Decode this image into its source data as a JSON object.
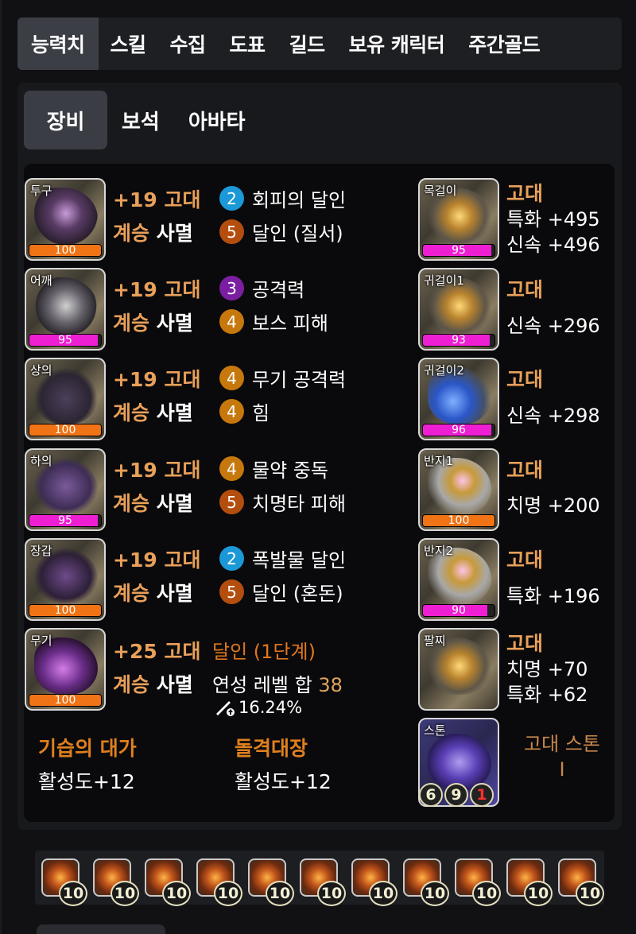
{
  "top_tabs": [
    "능력치",
    "스킬",
    "수집",
    "도표",
    "길드",
    "보유 캐릭터",
    "주간골드"
  ],
  "sub_tabs": [
    "장비",
    "보석",
    "아바타"
  ],
  "equipment": [
    {
      "slot": "투구",
      "quality": "100",
      "quality_pct": 100,
      "quality_color": "#f07316",
      "upgrade": "+19 고대",
      "succession_label": "계승",
      "set": "사멸",
      "engravings": [
        {
          "level": "2",
          "name": "회피의 달인",
          "color": "#1b98d8"
        },
        {
          "level": "5",
          "name": "달인 (질서)",
          "color": "#b44e0e"
        }
      ]
    },
    {
      "slot": "어깨",
      "quality": "95",
      "quality_pct": 95,
      "quality_color": "#ee1fd2",
      "upgrade": "+19 고대",
      "succession_label": "계승",
      "set": "사멸",
      "engravings": [
        {
          "level": "3",
          "name": "공격력",
          "color": "#7b1fa2"
        },
        {
          "level": "4",
          "name": "보스 피해",
          "color": "#c7780d"
        }
      ]
    },
    {
      "slot": "상의",
      "quality": "100",
      "quality_pct": 100,
      "quality_color": "#f07316",
      "upgrade": "+19 고대",
      "succession_label": "계승",
      "set": "사멸",
      "engravings": [
        {
          "level": "4",
          "name": "무기 공격력",
          "color": "#c7780d"
        },
        {
          "level": "4",
          "name": "힘",
          "color": "#c7780d"
        }
      ]
    },
    {
      "slot": "하의",
      "quality": "95",
      "quality_pct": 95,
      "quality_color": "#ee1fd2",
      "upgrade": "+19 고대",
      "succession_label": "계승",
      "set": "사멸",
      "engravings": [
        {
          "level": "4",
          "name": "물약 중독",
          "color": "#c7780d"
        },
        {
          "level": "5",
          "name": "치명타 피해",
          "color": "#b44e0e"
        }
      ]
    },
    {
      "slot": "장갑",
      "quality": "100",
      "quality_pct": 100,
      "quality_color": "#f07316",
      "upgrade": "+19 고대",
      "succession_label": "계승",
      "set": "사멸",
      "engravings": [
        {
          "level": "2",
          "name": "폭발물 달인",
          "color": "#1b98d8"
        },
        {
          "level": "5",
          "name": "달인 (혼돈)",
          "color": "#b44e0e"
        }
      ]
    }
  ],
  "weapon": {
    "slot": "무기",
    "quality": "100",
    "quality_pct": 100,
    "upgrade": "+25 고대",
    "succession_label": "계승",
    "set": "사멸",
    "mastery": "달인 (1단계)",
    "refine_label": "연성 레벨 합",
    "refine_value": "38",
    "stat": "16.24%"
  },
  "bracelet_effects": [
    {
      "title": "기습의 대가",
      "value": "활성도+12"
    },
    {
      "title": "돌격대장",
      "value": "활성도+12"
    }
  ],
  "accessories": [
    {
      "slot": "목걸이",
      "quality": "95",
      "quality_pct": 95,
      "quality_color": "#ee1fd2",
      "tier": "고대",
      "stats": [
        "특화 +495",
        "신속 +496"
      ]
    },
    {
      "slot": "귀걸이1",
      "quality": "93",
      "quality_pct": 93,
      "quality_color": "#ee1fd2",
      "tier": "고대",
      "stats": [
        "신속 +296"
      ]
    },
    {
      "slot": "귀걸이2",
      "quality": "96",
      "quality_pct": 96,
      "quality_color": "#ee1fd2",
      "tier": "고대",
      "stats": [
        "신속 +298"
      ]
    },
    {
      "slot": "반지1",
      "quality": "100",
      "quality_pct": 100,
      "quality_color": "#f07316",
      "tier": "고대",
      "stats": [
        "치명 +200"
      ]
    },
    {
      "slot": "반지2",
      "quality": "90",
      "quality_pct": 90,
      "quality_color": "#ee1fd2",
      "tier": "고대",
      "stats": [
        "특화 +196"
      ]
    },
    {
      "slot": "팔찌",
      "tier": "고대",
      "stats": [
        "치명 +70",
        "특화 +62"
      ]
    }
  ],
  "stone": {
    "slot": "스톤",
    "tier_text": "고대 스톤",
    "tier_suffix": "I",
    "nums": [
      "6",
      "9",
      "1"
    ]
  },
  "gems": [
    "10",
    "10",
    "10",
    "10",
    "10",
    "10",
    "10",
    "10",
    "10",
    "10",
    "10"
  ]
}
